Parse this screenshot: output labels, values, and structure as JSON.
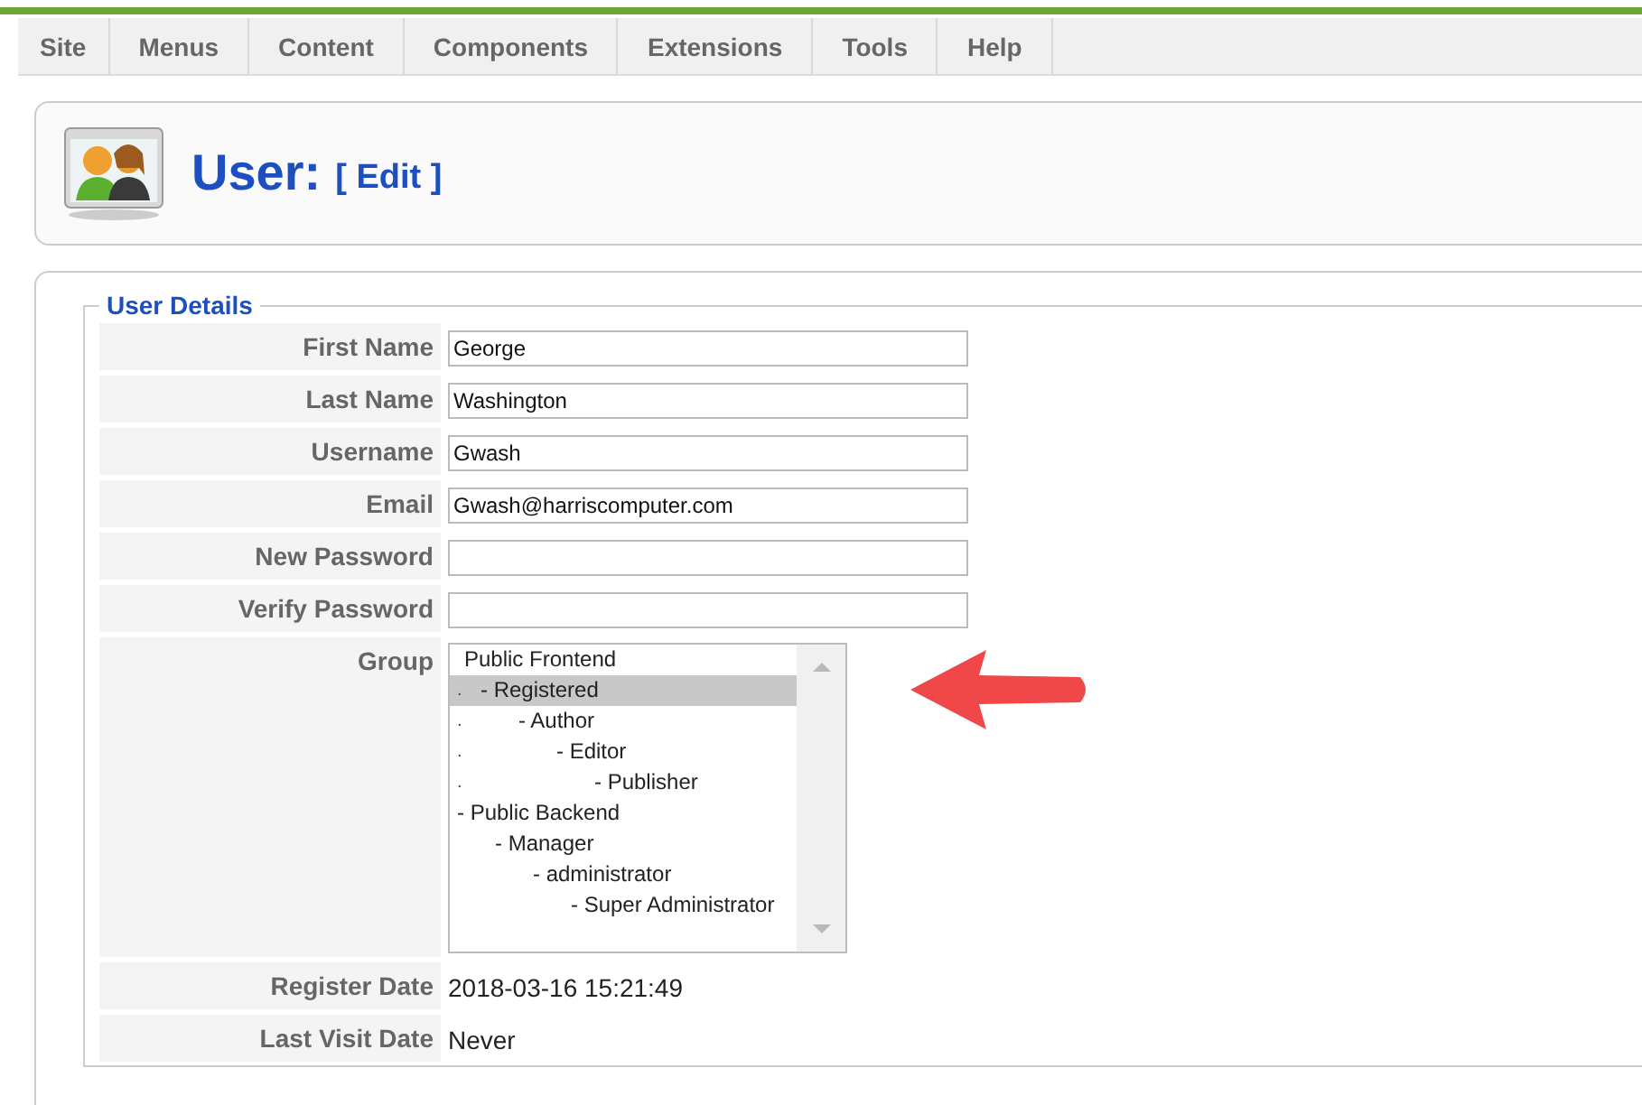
{
  "menu": [
    {
      "label": "Site"
    },
    {
      "label": "Menus"
    },
    {
      "label": "Content"
    },
    {
      "label": "Components"
    },
    {
      "label": "Extensions"
    },
    {
      "label": "Tools"
    },
    {
      "label": "Help"
    }
  ],
  "header": {
    "title": "User:",
    "subtitle": "[ Edit ]"
  },
  "details": {
    "legend": "User Details",
    "fields": [
      {
        "kind": "input",
        "label": "First Name",
        "value": "George"
      },
      {
        "kind": "input",
        "label": "Last Name",
        "value": "Washington"
      },
      {
        "kind": "input",
        "label": "Username",
        "value": "Gwash"
      },
      {
        "kind": "input",
        "label": "Email",
        "value": "Gwash@harriscomputer.com"
      },
      {
        "kind": "input",
        "label": "New Password"
      },
      {
        "kind": "input",
        "label": "Verify Password"
      },
      {
        "kind": "list",
        "label": "Group",
        "items": [
          {
            "label": "Public Frontend",
            "selected": false,
            "children": [
              {
                "lead": ".",
                "label": "- Registered",
                "selected": true,
                "children": [
                  {
                    "lead": ".",
                    "label": "- Author",
                    "selected": false,
                    "children": [
                      {
                        "lead": ".",
                        "label": "- Editor",
                        "selected": false,
                        "children": [
                          {
                            "lead": ".",
                            "label": "- Publisher",
                            "selected": false
                          }
                        ]
                      }
                    ]
                  }
                ]
              }
            ]
          },
          {
            "label": "- Public Backend",
            "selected": false,
            "children": [
              {
                "label": "- Manager",
                "selected": false,
                "children": [
                  {
                    "label": "- administrator",
                    "selected": false,
                    "children": [
                      {
                        "label": "- Super Administrator",
                        "selected": false
                      }
                    ]
                  }
                ]
              }
            ]
          }
        ]
      },
      {
        "kind": "text",
        "label": "Register Date",
        "value": "2018-03-16 15:21:49"
      },
      {
        "kind": "text",
        "label": "Last Visit Date",
        "value": "Never"
      }
    ]
  }
}
